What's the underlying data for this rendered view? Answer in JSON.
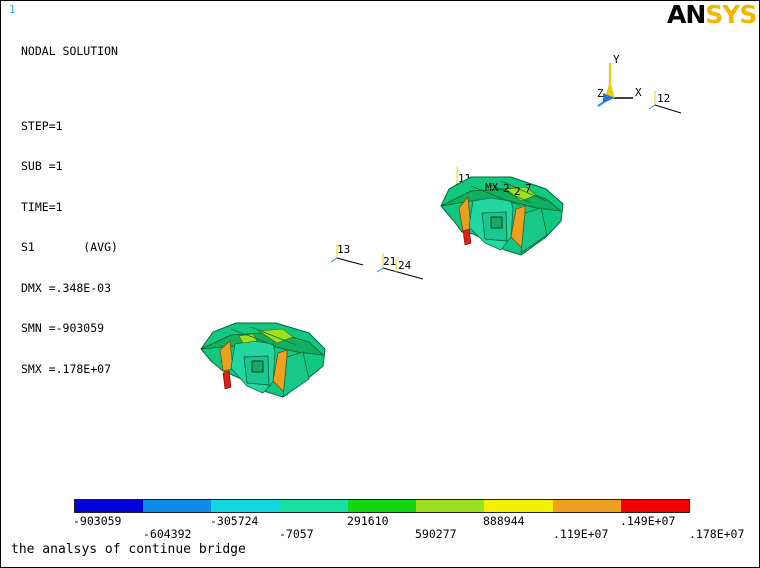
{
  "window": {
    "number": "1"
  },
  "info": {
    "title": "NODAL SOLUTION",
    "step": "STEP=1",
    "sub": "SUB =1",
    "time": "TIME=1",
    "result": "S1       (AVG)",
    "dmx": "DMX =.348E-03",
    "smn": "SMN =-903059",
    "smx": "SMX =.178E+07"
  },
  "logo": {
    "an": "AN",
    "sys": "SYS"
  },
  "axis": {
    "x": "X",
    "y": "Y",
    "z": "Z"
  },
  "markers": {
    "mx": "MX",
    "coord_labels": [
      "11",
      "12",
      "13",
      "21",
      "24",
      "2",
      "2",
      "7"
    ]
  },
  "legend": {
    "colors": [
      "#0000d8",
      "#0f8ce8",
      "#10d8e0",
      "#18e0a0",
      "#12d810",
      "#9ce020",
      "#f0f000",
      "#f0a020",
      "#f00000"
    ],
    "labels_top": [
      "-903059",
      "-305724",
      "291610",
      "888944",
      ".149E+07"
    ],
    "labels_bottom": [
      "-604392",
      "-7057",
      "590277",
      ".119E+07",
      ".178E+07"
    ]
  },
  "caption": "the analsys of continue bridge"
}
